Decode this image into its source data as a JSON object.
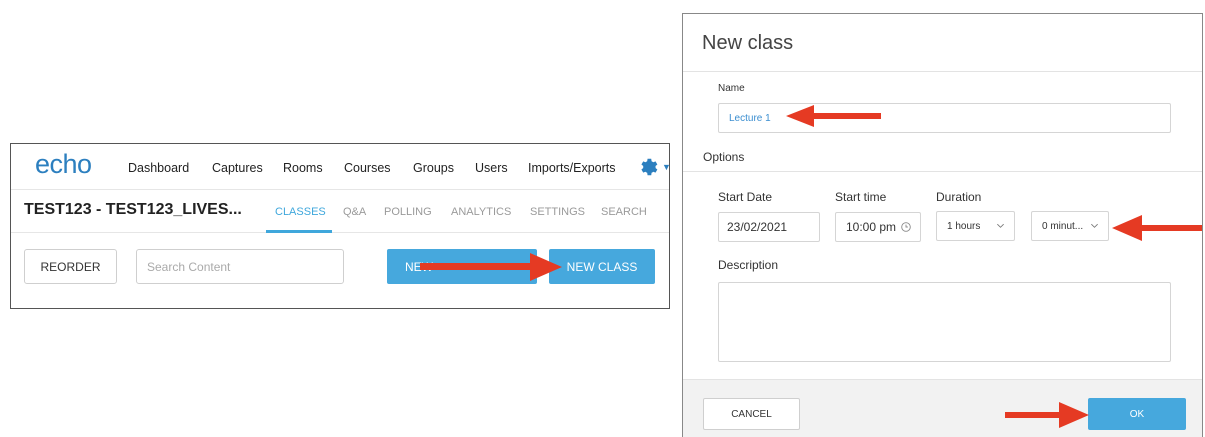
{
  "echo_page": {
    "logo": "echo",
    "nav_items": [
      "Dashboard",
      "Captures",
      "Rooms",
      "Courses",
      "Groups",
      "Users",
      "Imports/Exports"
    ],
    "course_title": "TEST123 - TEST123_LIVES...",
    "tabs": [
      {
        "label": "CLASSES",
        "active": true
      },
      {
        "label": "Q&A",
        "active": false
      },
      {
        "label": "POLLING",
        "active": false
      },
      {
        "label": "ANALYTICS",
        "active": false
      },
      {
        "label": "SETTINGS",
        "active": false
      },
      {
        "label": "SEARCH",
        "active": false
      }
    ],
    "reorder_label": "REORDER",
    "search_placeholder": "Search Content",
    "new_presentation_label": "NEW",
    "new_class_label": "NEW CLASS",
    "icons": {
      "settings": "gear-icon",
      "caret": "caret-down-icon"
    }
  },
  "modal": {
    "title": "New class",
    "name_label": "Name",
    "name_value": "Lecture 1",
    "options_label": "Options",
    "start_date_label": "Start Date",
    "start_date_value": "23/02/2021",
    "start_time_label": "Start time",
    "start_time_value": "10:00 pm",
    "duration_label": "Duration",
    "duration_hours": "1 hours",
    "duration_minutes": "0 minut...",
    "description_label": "Description",
    "cancel_label": "CANCEL",
    "ok_label": "OK"
  },
  "colors": {
    "accent_blue": "#46a8dd",
    "logo_blue": "#2c7fbf",
    "annotation_red": "#e53a23"
  }
}
